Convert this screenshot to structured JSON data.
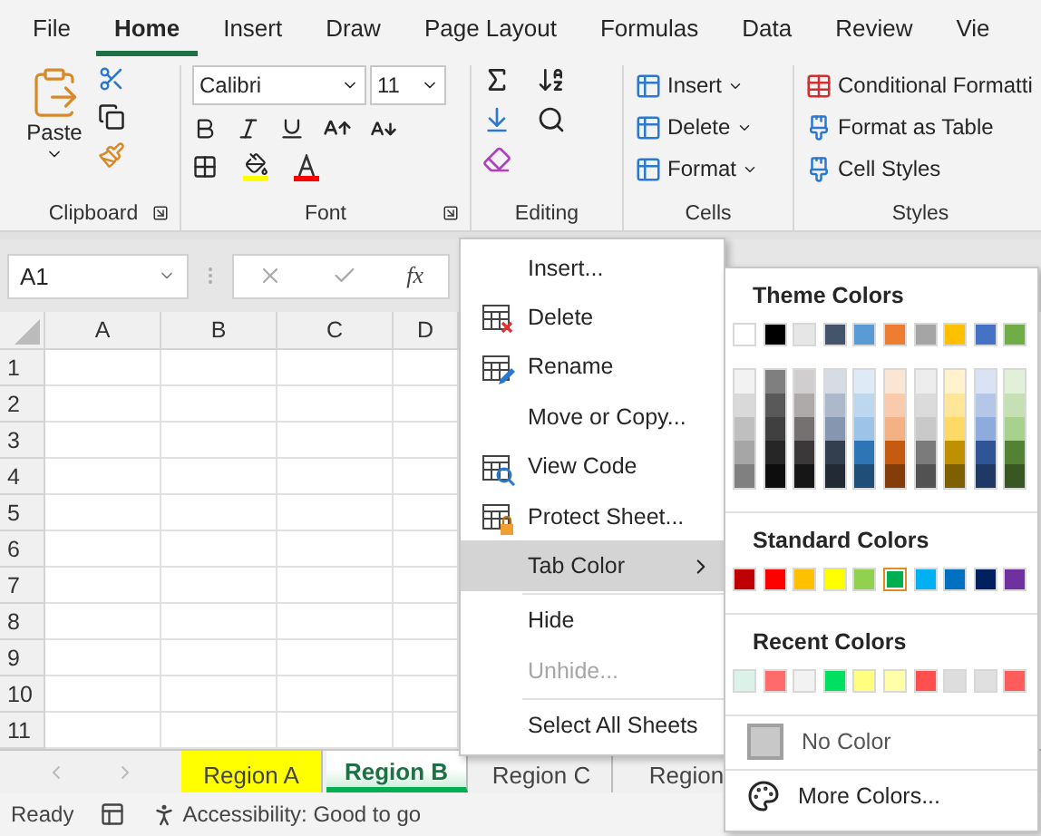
{
  "ribbon": {
    "tabs": [
      {
        "label": "File",
        "selected": false
      },
      {
        "label": "Home",
        "selected": true
      },
      {
        "label": "Insert",
        "selected": false
      },
      {
        "label": "Draw",
        "selected": false
      },
      {
        "label": "Page Layout",
        "selected": false
      },
      {
        "label": "Formulas",
        "selected": false
      },
      {
        "label": "Data",
        "selected": false
      },
      {
        "label": "Review",
        "selected": false
      },
      {
        "label": "Vie",
        "selected": false
      }
    ],
    "clipboard": {
      "label": "Clipboard",
      "paste": "Paste"
    },
    "font": {
      "label": "Font",
      "font_name": "Calibri",
      "font_size": "11"
    },
    "editing": {
      "label": "Editing"
    },
    "cells": {
      "label": "Cells",
      "buttons": [
        "Insert",
        "Delete",
        "Format"
      ]
    },
    "styles": {
      "label": "Styles",
      "buttons": [
        "Conditional Formatti",
        "Format as Table",
        "Cell Styles"
      ]
    }
  },
  "formula_bar": {
    "name_box": "A1",
    "fx_label": "fx"
  },
  "sheet": {
    "columns": [
      "A",
      "B",
      "C",
      "D"
    ],
    "rows": [
      "1",
      "2",
      "3",
      "4",
      "5",
      "6",
      "7",
      "8",
      "9",
      "10",
      "11"
    ]
  },
  "sheet_tabs": [
    {
      "label": "Region A",
      "color": "#ffff00",
      "selected": false
    },
    {
      "label": "Region B",
      "color": "#00b050",
      "selected": true
    },
    {
      "label": "Region C",
      "selected": false
    },
    {
      "label": "Region",
      "selected": false
    }
  ],
  "status_bar": {
    "mode": "Ready",
    "accessibility": "Accessibility: Good to go"
  },
  "context_menu": {
    "groups": [
      [
        {
          "label": "Insert...",
          "disabled": false,
          "selected": false
        },
        {
          "label": "Delete",
          "disabled": false,
          "selected": false
        },
        {
          "label": "Rename",
          "disabled": false,
          "selected": false
        },
        {
          "label": "Move or Copy...",
          "disabled": false,
          "selected": false
        },
        {
          "label": "View Code",
          "disabled": false,
          "selected": false
        },
        {
          "label": "Protect Sheet...",
          "disabled": false,
          "selected": false
        },
        {
          "label": "Tab Color",
          "disabled": false,
          "selected": true,
          "kind": "submenu"
        }
      ],
      [
        {
          "label": "Hide",
          "disabled": false,
          "selected": false
        },
        {
          "label": "Unhide...",
          "disabled": true,
          "selected": false
        }
      ],
      [
        {
          "label": "Select All Sheets",
          "disabled": false,
          "selected": false
        }
      ]
    ]
  },
  "color_menu": {
    "theme_title": "Theme Colors",
    "theme_colors": [
      {
        "color": "#ffffff",
        "shades": [
          {
            "color": "#f2f2f2"
          },
          {
            "color": "#d9d9d9"
          },
          {
            "color": "#bfbfbf"
          },
          {
            "color": "#a6a6a6"
          },
          {
            "color": "#808080"
          }
        ]
      },
      {
        "color": "#000000",
        "shades": [
          {
            "color": "#7f7f7f"
          },
          {
            "color": "#595959"
          },
          {
            "color": "#404040"
          },
          {
            "color": "#262626"
          },
          {
            "color": "#0d0d0d"
          }
        ]
      },
      {
        "color": "#e7e6e6",
        "shades": [
          {
            "color": "#d0cece"
          },
          {
            "color": "#aeaaaa"
          },
          {
            "color": "#757171"
          },
          {
            "color": "#3a3838"
          },
          {
            "color": "#171616"
          }
        ]
      },
      {
        "color": "#44546a",
        "shades": [
          {
            "color": "#d6dce4"
          },
          {
            "color": "#adb9ca"
          },
          {
            "color": "#8496b0"
          },
          {
            "color": "#333f4f"
          },
          {
            "color": "#222a35"
          }
        ]
      },
      {
        "color": "#5b9bd5",
        "shades": [
          {
            "color": "#deebf6"
          },
          {
            "color": "#bdd7ee"
          },
          {
            "color": "#9dc3e6"
          },
          {
            "color": "#2e75b5"
          },
          {
            "color": "#1f4e79"
          }
        ]
      },
      {
        "color": "#ed7d31",
        "shades": [
          {
            "color": "#fbe5d5"
          },
          {
            "color": "#f8cbad"
          },
          {
            "color": "#f4b183"
          },
          {
            "color": "#c55a11"
          },
          {
            "color": "#843c0b"
          }
        ]
      },
      {
        "color": "#a5a5a5",
        "shades": [
          {
            "color": "#ededed"
          },
          {
            "color": "#dbdbdb"
          },
          {
            "color": "#c9c9c9"
          },
          {
            "color": "#7b7b7b"
          },
          {
            "color": "#525252"
          }
        ]
      },
      {
        "color": "#ffc000",
        "shades": [
          {
            "color": "#fff2cc"
          },
          {
            "color": "#ffe699"
          },
          {
            "color": "#ffd966"
          },
          {
            "color": "#bf9000"
          },
          {
            "color": "#7f6000"
          }
        ]
      },
      {
        "color": "#4472c4",
        "shades": [
          {
            "color": "#dae3f3"
          },
          {
            "color": "#b4c7e7"
          },
          {
            "color": "#8faadc"
          },
          {
            "color": "#2f5597"
          },
          {
            "color": "#203864"
          }
        ]
      },
      {
        "color": "#70ad47",
        "shades": [
          {
            "color": "#e2f0d9"
          },
          {
            "color": "#c5e0b4"
          },
          {
            "color": "#a9d18e"
          },
          {
            "color": "#548235"
          },
          {
            "color": "#385723"
          }
        ]
      }
    ],
    "standard_title": "Standard Colors",
    "standard_colors": [
      {
        "color": "#c00000",
        "selected": false
      },
      {
        "color": "#ff0000",
        "selected": false
      },
      {
        "color": "#ffc000",
        "selected": false
      },
      {
        "color": "#ffff00",
        "selected": false
      },
      {
        "color": "#92d050",
        "selected": false
      },
      {
        "color": "#00b050",
        "selected": true
      },
      {
        "color": "#00b0f0",
        "selected": false
      },
      {
        "color": "#0070c0",
        "selected": false
      },
      {
        "color": "#002060",
        "selected": false
      },
      {
        "color": "#7030a0",
        "selected": false
      }
    ],
    "recent_title": "Recent Colors",
    "recent_colors": [
      {
        "color": "#daf2e8"
      },
      {
        "color": "#ff6b6b"
      },
      {
        "color": "#f2f2f2"
      },
      {
        "color": "#00e060"
      },
      {
        "color": "#ffff80"
      },
      {
        "color": "#ffffaa"
      },
      {
        "color": "#ff4f4f"
      },
      {
        "color": "#dddddd"
      },
      {
        "color": "#e0e0e0"
      },
      {
        "color": "#ff5c5c"
      }
    ],
    "no_color": "No Color",
    "more_colors": "More Colors..."
  }
}
